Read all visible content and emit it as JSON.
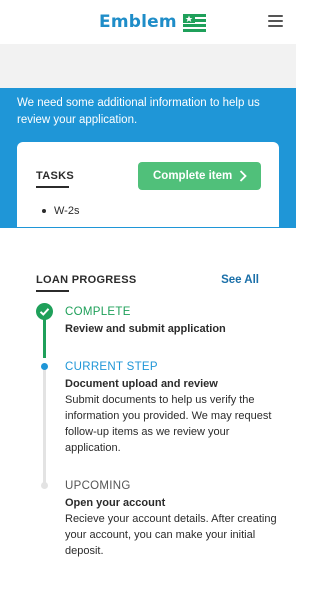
{
  "header": {
    "logo_text": "Emblem",
    "logo_icon": "emblem-flag-icon",
    "menu_icon": "hamburger-menu-icon"
  },
  "notice": {
    "text": "We need some additional information to help us review your application."
  },
  "tasks": {
    "title": "TASKS",
    "button_label": "Complete item",
    "items": [
      "W-2s"
    ]
  },
  "loan_progress": {
    "title": "LOAN PROGRESS",
    "see_all": "See All",
    "steps": [
      {
        "status": "COMPLETE",
        "title": "Review and submit application",
        "description": ""
      },
      {
        "status": "CURRENT STEP",
        "title": "Document upload and review",
        "description": "Submit documents to help us verify the information you provided. We may request follow-up items as we review your application."
      },
      {
        "status": "UPCOMING",
        "title": "Open your account",
        "description": "Recieve your account details. After creating your account, you can make your initial deposit."
      }
    ]
  },
  "colors": {
    "brand_blue": "#1f96d7",
    "brand_green": "#50c07a",
    "complete_green": "#1fa05a",
    "link_blue": "#1a6fa8"
  }
}
